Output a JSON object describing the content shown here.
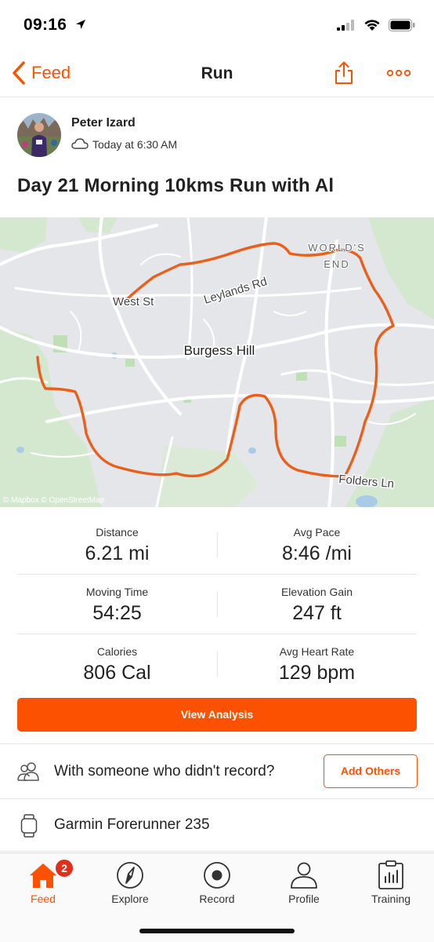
{
  "status_bar": {
    "time": "09:16"
  },
  "nav": {
    "back_label": "Feed",
    "title": "Run"
  },
  "athlete": {
    "name": "Peter Izard",
    "time": "Today at 6:30 AM"
  },
  "activity": {
    "title": "Day 21 Morning 10kms Run with Al"
  },
  "map": {
    "labels": {
      "town": "Burgess Hill",
      "road1": "Leylands Rd",
      "road2": "West St",
      "area_line1": "WORLD'S",
      "area_line2": "END",
      "road3": "Folders Ln"
    },
    "attribution": "© Mapbox © OpenStreetMap",
    "route_color": "#e8601c"
  },
  "stats": [
    {
      "left": {
        "label": "Distance",
        "value": "6.21 mi"
      },
      "right": {
        "label": "Avg Pace",
        "value": "8:46 /mi"
      }
    },
    {
      "left": {
        "label": "Moving Time",
        "value": "54:25"
      },
      "right": {
        "label": "Elevation Gain",
        "value": "247 ft"
      }
    },
    {
      "left": {
        "label": "Calories",
        "value": "806 Cal"
      },
      "right": {
        "label": "Avg Heart Rate",
        "value": "129 bpm"
      }
    }
  ],
  "buttons": {
    "view_analysis": "View Analysis",
    "add_others": "Add Others"
  },
  "with_others": {
    "text": "With someone who didn't record?"
  },
  "device": {
    "name": "Garmin Forerunner 235"
  },
  "tabs": [
    {
      "label": "Feed",
      "icon": "home-icon",
      "badge": "2"
    },
    {
      "label": "Explore",
      "icon": "compass-icon"
    },
    {
      "label": "Record",
      "icon": "record-icon"
    },
    {
      "label": "Profile",
      "icon": "profile-icon"
    },
    {
      "label": "Training",
      "icon": "training-icon"
    }
  ],
  "colors": {
    "accent": "#fc5200",
    "badge": "#e02e1f"
  }
}
